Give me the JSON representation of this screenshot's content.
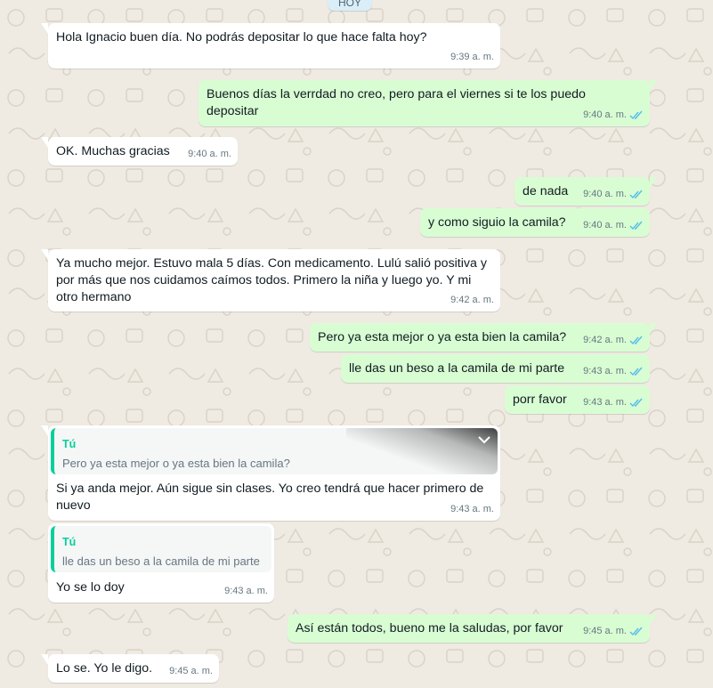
{
  "day_label": "HOY",
  "colors": {
    "incoming_bubble": "#ffffff",
    "outgoing_bubble": "#d9fdd3",
    "read_ticks": "#53bdeb",
    "reply_accent": "#06cf9c",
    "chat_background": "#efeae2"
  },
  "messages": [
    {
      "text": "Hola Ignacio buen día. No podrás depositar lo que hace falta hoy?",
      "time": "9:39 a. m."
    },
    {
      "text": "Buenos días la verrdad no creo, pero para el viernes si te los puedo depositar",
      "time": "9:40 a. m."
    },
    {
      "text": "OK. Muchas gracias",
      "time": "9:40 a. m."
    },
    {
      "text": "de nada",
      "time": "9:40 a. m."
    },
    {
      "text": "y como siguio la camila?",
      "time": "9:40 a. m."
    },
    {
      "text": "Ya mucho mejor. Estuvo mala 5 días. Con medicamento. Lulú salió positiva y por más que nos cuidamos caímos todos. Primero la niña y luego yo. Y mi otro hermano",
      "time": "9:42 a. m."
    },
    {
      "text": "Pero ya esta mejor o ya esta bien la camila?",
      "time": "9:42 a. m."
    },
    {
      "text": "lle das un beso a la camila de mi parte",
      "time": "9:43 a. m."
    },
    {
      "text": "porr favor",
      "time": "9:43 a. m."
    },
    {
      "text": "Si ya anda mejor. Aún sigue sin clases. Yo creo tendrá que hacer primero de nuevo",
      "time": "9:43 a. m.",
      "reply": {
        "author": "Tú",
        "text": "Pero ya esta mejor o ya esta bien la camila?"
      }
    },
    {
      "text": "Yo se lo doy",
      "time": "9:43 a. m.",
      "reply": {
        "author": "Tú",
        "text": "lle das un beso a la camila de mi parte"
      }
    },
    {
      "text": "Así están todos, bueno me la saludas, por favor",
      "time": "9:45 a. m."
    },
    {
      "text": "Lo se. Yo le digo.",
      "time": "9:45 a. m."
    }
  ]
}
